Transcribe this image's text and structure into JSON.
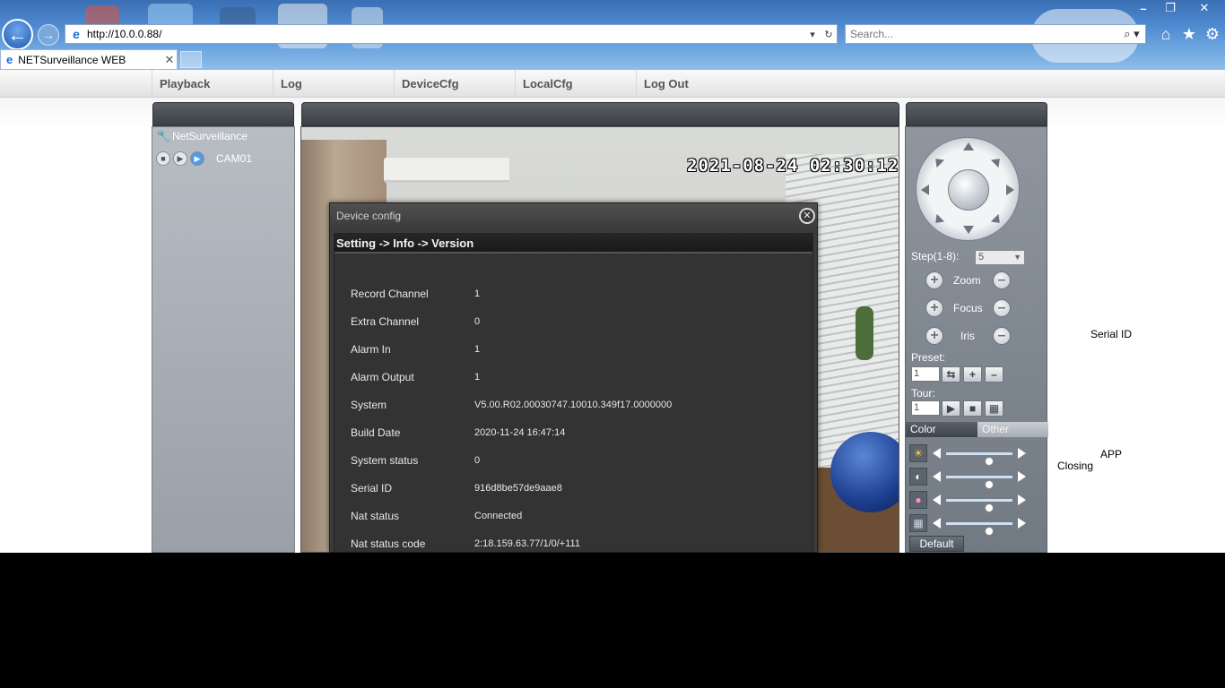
{
  "browser": {
    "url": "http://10.0.0.88/",
    "search_placeholder": "Search...",
    "tab_title": "NETSurveillance WEB",
    "tab_close": "✕",
    "window_controls": [
      "–",
      "❐",
      "✕"
    ]
  },
  "nav": {
    "items": [
      "Playback",
      "Log",
      "DeviceCfg",
      "LocalCfg",
      "Log Out"
    ]
  },
  "device_tree": {
    "root_label": "NetSurveillance",
    "channel_label": "CAM01"
  },
  "video": {
    "timestamp": "2021-08-24 02:30:12"
  },
  "dialog": {
    "title": "Device config",
    "close": "✕",
    "breadcrumb": "Setting -> Info -> Version",
    "rows": [
      {
        "label": "Record Channel",
        "value": "1"
      },
      {
        "label": "Extra Channel",
        "value": "0"
      },
      {
        "label": "Alarm In",
        "value": "1"
      },
      {
        "label": "Alarm Output",
        "value": "1"
      },
      {
        "label": "System",
        "value": "V5.00.R02.00030747.10010.349f17.0000000"
      },
      {
        "label": "Build Date",
        "value": "2020-11-24 16:47:14"
      },
      {
        "label": "System status",
        "value": "0"
      },
      {
        "label": "Serial ID",
        "value": "916d8be57de9aae8"
      },
      {
        "label": "Nat status",
        "value": "Connected"
      },
      {
        "label": "Nat status code",
        "value": "2:18.159.63.77/1/0/+111"
      }
    ]
  },
  "ptz": {
    "step_label": "Step(1-8):",
    "step_value": "5",
    "zoom_label": "Zoom",
    "focus_label": "Focus",
    "iris_label": "Iris",
    "preset_label": "Preset:",
    "preset_value": "1",
    "tour_label": "Tour:",
    "tour_value": "1",
    "plus": "+",
    "minus": "–"
  },
  "color_panel": {
    "tab_color": "Color",
    "tab_other": "Other",
    "sliders": [
      {
        "icon": "brightness-icon",
        "level": 0.65
      },
      {
        "icon": "contrast-icon",
        "level": 0.65
      },
      {
        "icon": "saturation-icon",
        "level": 0.65
      },
      {
        "icon": "hue-icon",
        "level": 0.65
      }
    ],
    "default_label": "Default"
  },
  "stray_text": {
    "serial_id": "Serial ID",
    "app": "APP",
    "closing": "Closing"
  }
}
